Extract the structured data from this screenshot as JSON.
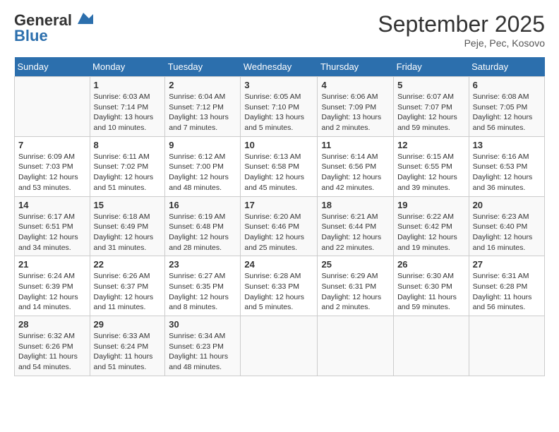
{
  "header": {
    "logo_line1": "General",
    "logo_line2": "Blue",
    "month_title": "September 2025",
    "subtitle": "Peje, Pec, Kosovo"
  },
  "weekdays": [
    "Sunday",
    "Monday",
    "Tuesday",
    "Wednesday",
    "Thursday",
    "Friday",
    "Saturday"
  ],
  "weeks": [
    [
      {
        "day": "",
        "sunrise": "",
        "sunset": "",
        "daylight": ""
      },
      {
        "day": "1",
        "sunrise": "Sunrise: 6:03 AM",
        "sunset": "Sunset: 7:14 PM",
        "daylight": "Daylight: 13 hours and 10 minutes."
      },
      {
        "day": "2",
        "sunrise": "Sunrise: 6:04 AM",
        "sunset": "Sunset: 7:12 PM",
        "daylight": "Daylight: 13 hours and 7 minutes."
      },
      {
        "day": "3",
        "sunrise": "Sunrise: 6:05 AM",
        "sunset": "Sunset: 7:10 PM",
        "daylight": "Daylight: 13 hours and 5 minutes."
      },
      {
        "day": "4",
        "sunrise": "Sunrise: 6:06 AM",
        "sunset": "Sunset: 7:09 PM",
        "daylight": "Daylight: 13 hours and 2 minutes."
      },
      {
        "day": "5",
        "sunrise": "Sunrise: 6:07 AM",
        "sunset": "Sunset: 7:07 PM",
        "daylight": "Daylight: 12 hours and 59 minutes."
      },
      {
        "day": "6",
        "sunrise": "Sunrise: 6:08 AM",
        "sunset": "Sunset: 7:05 PM",
        "daylight": "Daylight: 12 hours and 56 minutes."
      }
    ],
    [
      {
        "day": "7",
        "sunrise": "Sunrise: 6:09 AM",
        "sunset": "Sunset: 7:03 PM",
        "daylight": "Daylight: 12 hours and 53 minutes."
      },
      {
        "day": "8",
        "sunrise": "Sunrise: 6:11 AM",
        "sunset": "Sunset: 7:02 PM",
        "daylight": "Daylight: 12 hours and 51 minutes."
      },
      {
        "day": "9",
        "sunrise": "Sunrise: 6:12 AM",
        "sunset": "Sunset: 7:00 PM",
        "daylight": "Daylight: 12 hours and 48 minutes."
      },
      {
        "day": "10",
        "sunrise": "Sunrise: 6:13 AM",
        "sunset": "Sunset: 6:58 PM",
        "daylight": "Daylight: 12 hours and 45 minutes."
      },
      {
        "day": "11",
        "sunrise": "Sunrise: 6:14 AM",
        "sunset": "Sunset: 6:56 PM",
        "daylight": "Daylight: 12 hours and 42 minutes."
      },
      {
        "day": "12",
        "sunrise": "Sunrise: 6:15 AM",
        "sunset": "Sunset: 6:55 PM",
        "daylight": "Daylight: 12 hours and 39 minutes."
      },
      {
        "day": "13",
        "sunrise": "Sunrise: 6:16 AM",
        "sunset": "Sunset: 6:53 PM",
        "daylight": "Daylight: 12 hours and 36 minutes."
      }
    ],
    [
      {
        "day": "14",
        "sunrise": "Sunrise: 6:17 AM",
        "sunset": "Sunset: 6:51 PM",
        "daylight": "Daylight: 12 hours and 34 minutes."
      },
      {
        "day": "15",
        "sunrise": "Sunrise: 6:18 AM",
        "sunset": "Sunset: 6:49 PM",
        "daylight": "Daylight: 12 hours and 31 minutes."
      },
      {
        "day": "16",
        "sunrise": "Sunrise: 6:19 AM",
        "sunset": "Sunset: 6:48 PM",
        "daylight": "Daylight: 12 hours and 28 minutes."
      },
      {
        "day": "17",
        "sunrise": "Sunrise: 6:20 AM",
        "sunset": "Sunset: 6:46 PM",
        "daylight": "Daylight: 12 hours and 25 minutes."
      },
      {
        "day": "18",
        "sunrise": "Sunrise: 6:21 AM",
        "sunset": "Sunset: 6:44 PM",
        "daylight": "Daylight: 12 hours and 22 minutes."
      },
      {
        "day": "19",
        "sunrise": "Sunrise: 6:22 AM",
        "sunset": "Sunset: 6:42 PM",
        "daylight": "Daylight: 12 hours and 19 minutes."
      },
      {
        "day": "20",
        "sunrise": "Sunrise: 6:23 AM",
        "sunset": "Sunset: 6:40 PM",
        "daylight": "Daylight: 12 hours and 16 minutes."
      }
    ],
    [
      {
        "day": "21",
        "sunrise": "Sunrise: 6:24 AM",
        "sunset": "Sunset: 6:39 PM",
        "daylight": "Daylight: 12 hours and 14 minutes."
      },
      {
        "day": "22",
        "sunrise": "Sunrise: 6:26 AM",
        "sunset": "Sunset: 6:37 PM",
        "daylight": "Daylight: 12 hours and 11 minutes."
      },
      {
        "day": "23",
        "sunrise": "Sunrise: 6:27 AM",
        "sunset": "Sunset: 6:35 PM",
        "daylight": "Daylight: 12 hours and 8 minutes."
      },
      {
        "day": "24",
        "sunrise": "Sunrise: 6:28 AM",
        "sunset": "Sunset: 6:33 PM",
        "daylight": "Daylight: 12 hours and 5 minutes."
      },
      {
        "day": "25",
        "sunrise": "Sunrise: 6:29 AM",
        "sunset": "Sunset: 6:31 PM",
        "daylight": "Daylight: 12 hours and 2 minutes."
      },
      {
        "day": "26",
        "sunrise": "Sunrise: 6:30 AM",
        "sunset": "Sunset: 6:30 PM",
        "daylight": "Daylight: 11 hours and 59 minutes."
      },
      {
        "day": "27",
        "sunrise": "Sunrise: 6:31 AM",
        "sunset": "Sunset: 6:28 PM",
        "daylight": "Daylight: 11 hours and 56 minutes."
      }
    ],
    [
      {
        "day": "28",
        "sunrise": "Sunrise: 6:32 AM",
        "sunset": "Sunset: 6:26 PM",
        "daylight": "Daylight: 11 hours and 54 minutes."
      },
      {
        "day": "29",
        "sunrise": "Sunrise: 6:33 AM",
        "sunset": "Sunset: 6:24 PM",
        "daylight": "Daylight: 11 hours and 51 minutes."
      },
      {
        "day": "30",
        "sunrise": "Sunrise: 6:34 AM",
        "sunset": "Sunset: 6:23 PM",
        "daylight": "Daylight: 11 hours and 48 minutes."
      },
      {
        "day": "",
        "sunrise": "",
        "sunset": "",
        "daylight": ""
      },
      {
        "day": "",
        "sunrise": "",
        "sunset": "",
        "daylight": ""
      },
      {
        "day": "",
        "sunrise": "",
        "sunset": "",
        "daylight": ""
      },
      {
        "day": "",
        "sunrise": "",
        "sunset": "",
        "daylight": ""
      }
    ]
  ]
}
